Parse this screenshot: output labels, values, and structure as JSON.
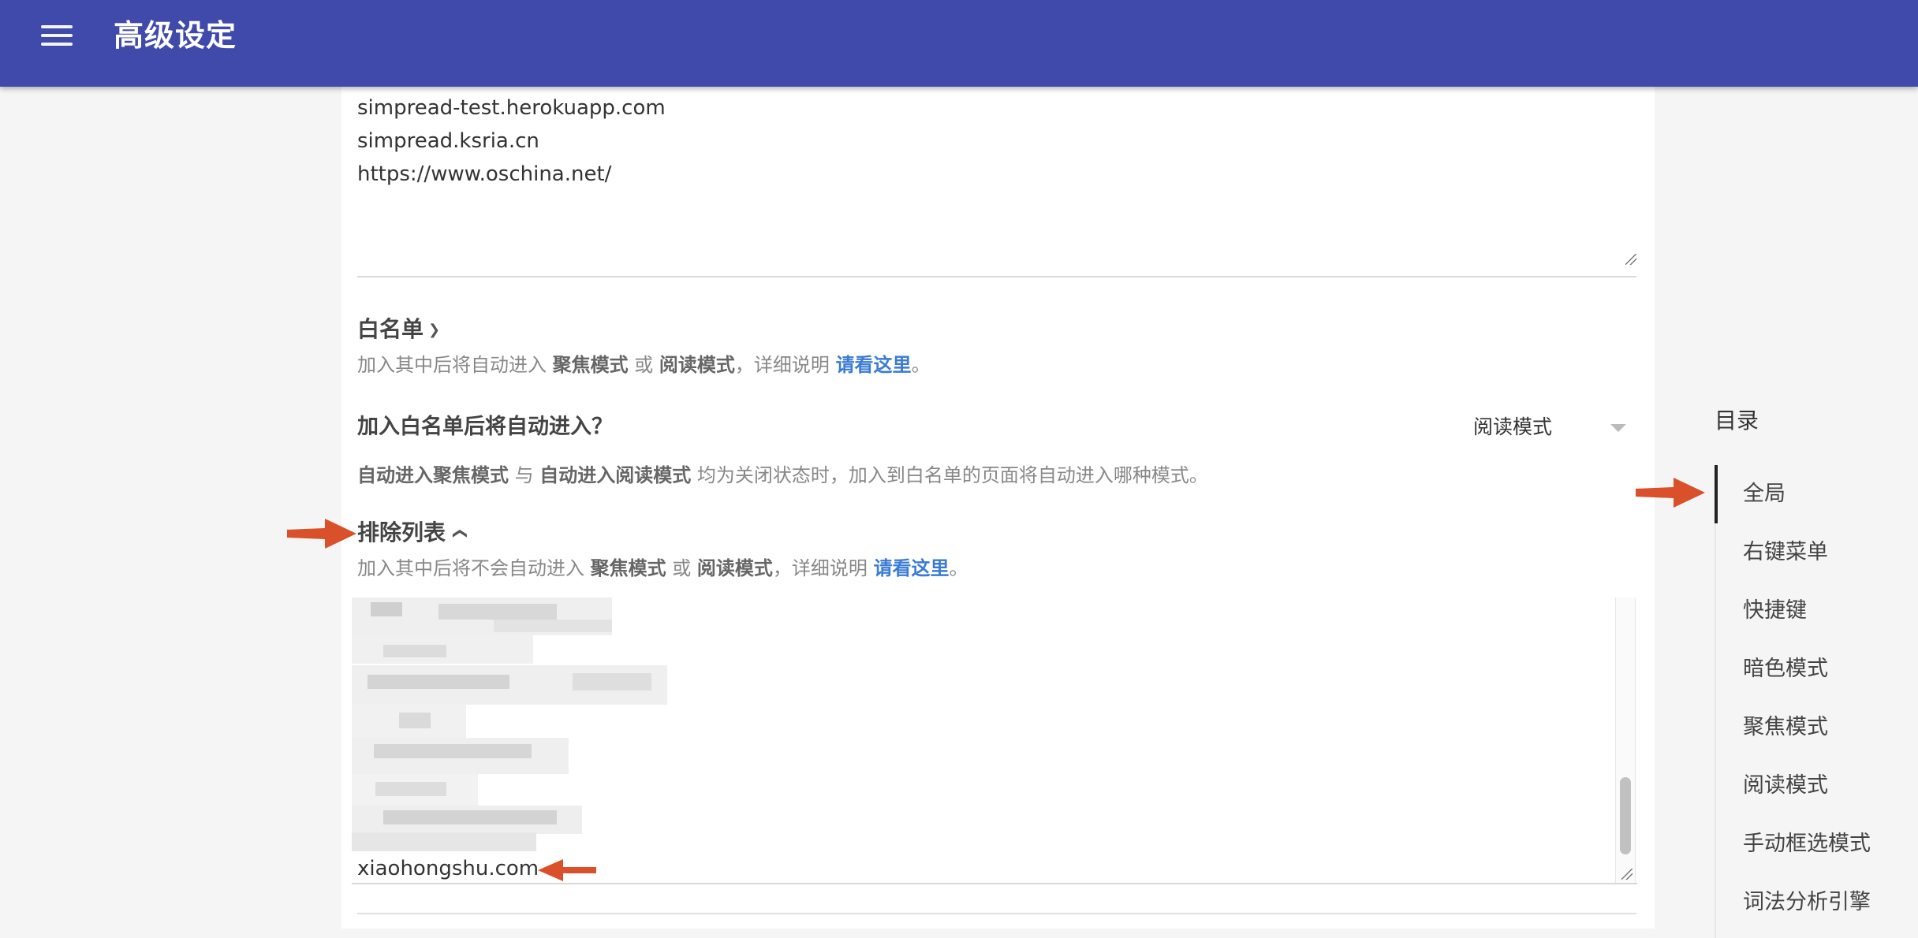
{
  "header": {
    "title": "高级设定",
    "menu_icon": "hamburger-menu-icon",
    "background_color": "#3f4aab"
  },
  "url_list_1": [
    "simpread-test.herokuapp.com",
    "simpread.ksria.cn",
    "https://www.oschina.net/"
  ],
  "whitelist": {
    "title": "白名单",
    "chevron_icon": "chevron-down-icon",
    "desc_prefix": "加入其中后将自动进入",
    "desc_focus": "聚焦模式",
    "desc_or": "或",
    "desc_read": "阅读模式",
    "desc_mid": "，详细说明",
    "desc_link": "请看这里",
    "desc_end": "。"
  },
  "auto_enter": {
    "label": "加入白名单后将自动进入？",
    "selected": "阅读模式",
    "desc_a": "自动进入聚焦模式",
    "desc_with": "与",
    "desc_b": "自动进入阅读模式",
    "desc_rest": "均为关闭状态时，加入到白名单的页面将自动进入哪种模式。"
  },
  "exclude": {
    "title": "排除列表",
    "chevron_icon": "chevron-up-icon",
    "desc_prefix": "加入其中后将不会自动进入",
    "desc_focus": "聚焦模式",
    "desc_or": "或",
    "desc_read": "阅读模式",
    "desc_mid": "，详细说明",
    "desc_link": "请看这里",
    "desc_end": "。",
    "last_entry": "xiaohongshu.com"
  },
  "toc": {
    "title": "目录",
    "items": [
      "全局",
      "右键菜单",
      "快捷键",
      "暗色模式",
      "聚焦模式",
      "阅读模式",
      "手动框选模式",
      "词法分析引擎"
    ],
    "active_index": 0
  },
  "colors": {
    "accent": "#3f4aab",
    "link": "#3a7bd5",
    "annotation_arrow": "#d9502a"
  }
}
